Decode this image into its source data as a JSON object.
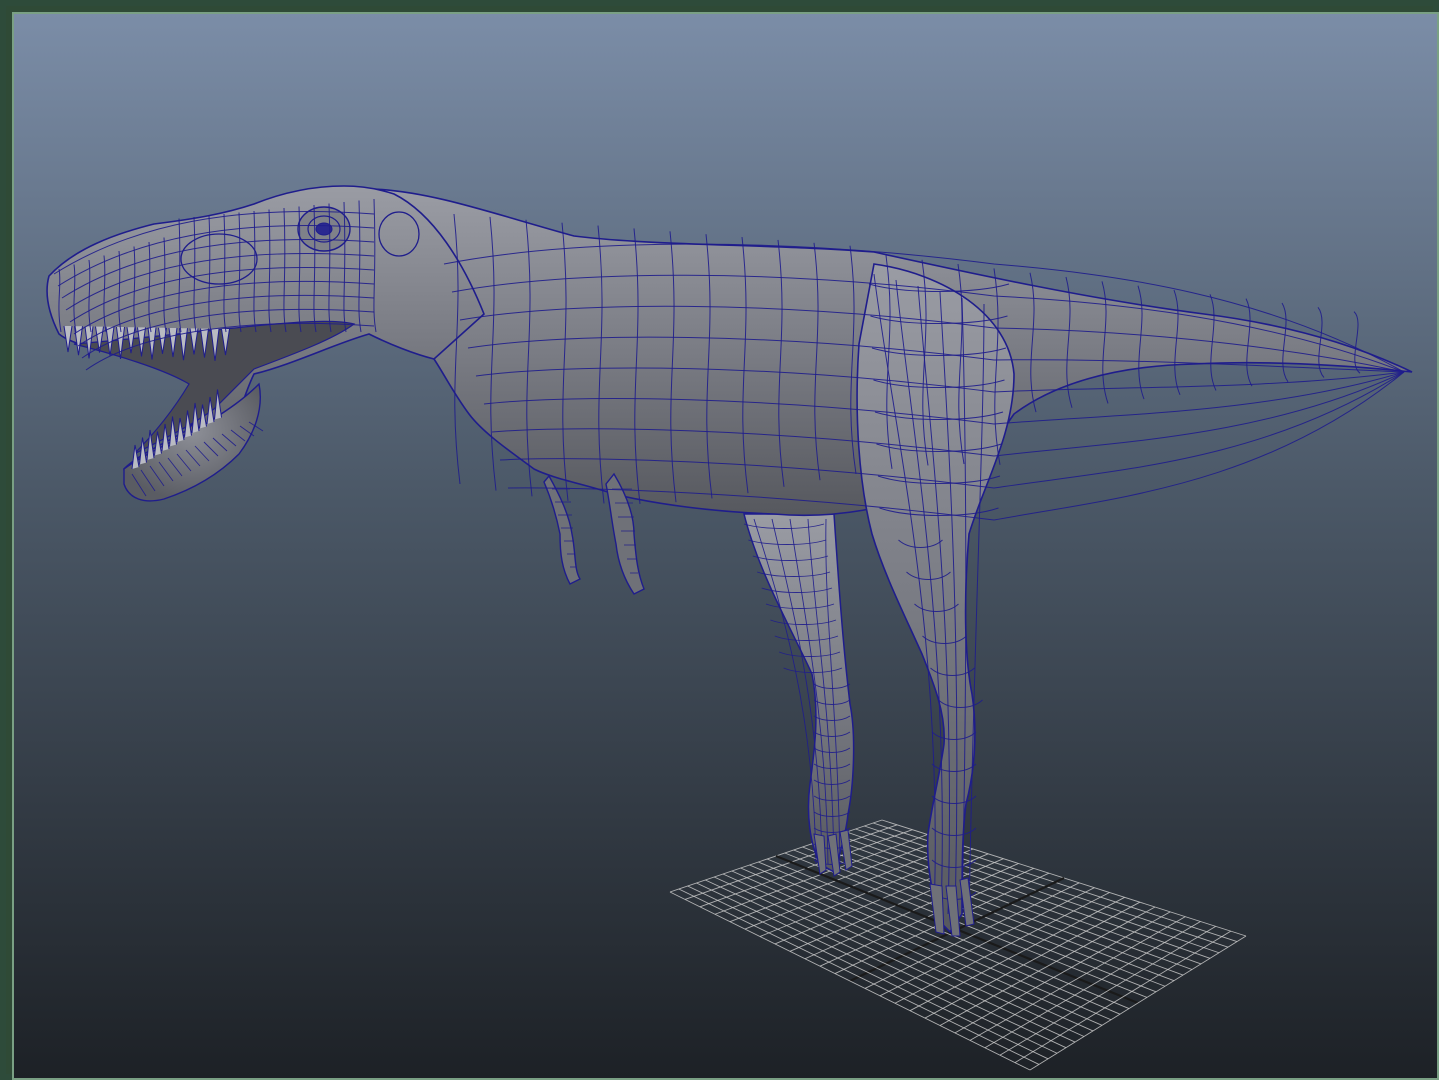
{
  "viewport": {
    "name": "perspective-viewport",
    "background": {
      "top_color": "#7b8da7",
      "mid_color": "#4b5867",
      "bottom_color": "#1d2126"
    },
    "frame_color": "#2e4b3a"
  },
  "model": {
    "name": "t-rex",
    "display_mode": "smooth-shade-with-wireframe",
    "surface_color": "#7a7c84",
    "wireframe_color": "#1f1d8c"
  },
  "ground_grid": {
    "visible": true,
    "line_color": "#c8c8c8",
    "axis_color": "#1a1a1a"
  }
}
